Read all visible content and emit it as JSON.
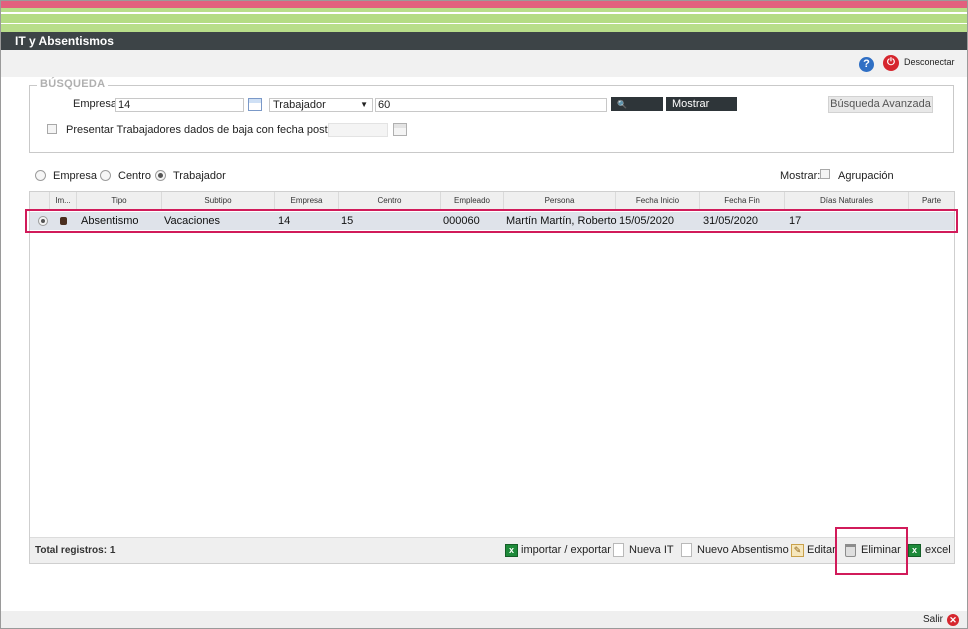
{
  "window": {
    "title": "IT y Absentismos"
  },
  "topbar": {
    "help_icon": "?",
    "logout_label": "Desconectar"
  },
  "search": {
    "legend": "BÚSQUEDA",
    "empresa_label": "Empresa",
    "empresa_value": "14",
    "type_select_value": "Trabajador",
    "select_arrow": "▼",
    "trabajador_value": "60",
    "buscar_label": "Buscar",
    "mostrar_todo_label": "Mostrar Todo",
    "advanced_label": "Búsqueda Avanzada",
    "baja_label": "Presentar Trabajadores dados de baja con fecha posterior a",
    "baja_date_value": ""
  },
  "grouping": {
    "options": [
      "Empresa",
      "Centro",
      "Trabajador"
    ],
    "selected": "Trabajador",
    "mostrar_label": "Mostrar:",
    "agrupacion_label": "Agrupación"
  },
  "grid": {
    "columns": [
      "Im...",
      "Tipo",
      "Subtipo",
      "Empresa",
      "Centro",
      "Empleado",
      "Persona",
      "Fecha Inicio",
      "Fecha Fin",
      "Días Naturales",
      "Parte"
    ],
    "rows": [
      {
        "tipo": "Absentismo",
        "subtipo": "Vacaciones",
        "empresa": "14",
        "centro": "15",
        "empleado": "000060",
        "persona": "Martín Martín, Roberto",
        "fecha_inicio": "15/05/2020",
        "fecha_fin": "31/05/2020",
        "dias_naturales": "17",
        "parte": ""
      }
    ]
  },
  "footer": {
    "total_label": "Total registros: 1",
    "import_export_label": "importar / exportar",
    "nueva_it_label": "Nueva IT",
    "nuevo_absentismo_label": "Nuevo Absentismo",
    "editar_label": "Editar",
    "eliminar_label": "Eliminar",
    "excel_label": "excel"
  },
  "bottombar": {
    "salir_label": "Salir"
  },
  "colors": {
    "accent_pink": "#e2607e",
    "accent_green": "#b8de8a",
    "titlebar": "#3d4447",
    "highlight": "#d11b5a"
  }
}
